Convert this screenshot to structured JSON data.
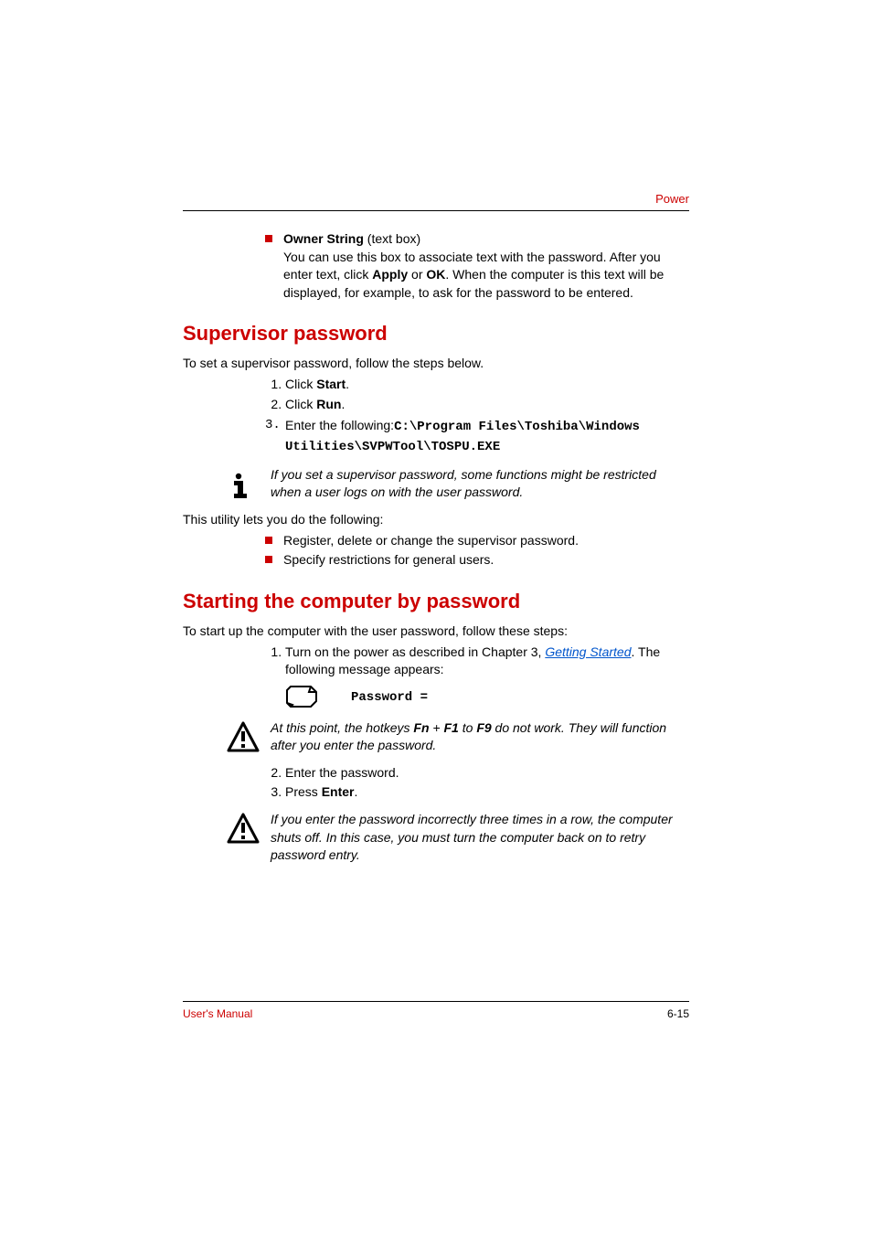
{
  "header": {
    "label": "Power"
  },
  "owner_bullet": {
    "title_bold": "Owner String",
    "title_rest": " (text box)",
    "desc1": "You can use this box to associate text with the password. After you enter text, click ",
    "desc_b1": "Apply",
    "desc_mid": " or ",
    "desc_b2": "OK",
    "desc2": ". When the computer is this text will be displayed, for example, to ask for the password to be entered."
  },
  "supervisor": {
    "heading": "Supervisor password",
    "intro": "To set a supervisor password, follow the steps below.",
    "step1_pre": "Click ",
    "step1_bold": "Start",
    "step1_post": ".",
    "step2_pre": "Click ",
    "step2_bold": "Run",
    "step2_post": ".",
    "step3_num": "3.",
    "step3_pre": "Enter the following:",
    "step3_code": "C:\\Program Files\\Toshiba\\Windows Utilities\\SVPWTool\\TOSPU.EXE",
    "note": "If you set a supervisor password, some functions might be restricted when a user logs on with the user password.",
    "utility_line": "This utility lets you do the following:",
    "bul1": "Register, delete or change the supervisor password.",
    "bul2": "Specify restrictions for general users."
  },
  "starting": {
    "heading": "Starting the computer by password",
    "intro": "To start up the computer with the user password, follow these steps:",
    "step1_pre": "Turn on the power as described in Chapter 3, ",
    "step1_link": "Getting Started",
    "step1_post": ". The following message appears:",
    "password_label": "Password =",
    "note1_pre": "At this point, the hotkeys ",
    "note1_b1": "Fn",
    "note1_plus": " + ",
    "note1_b2": "F1",
    "note1_mid": " to ",
    "note1_b3": "F9",
    "note1_post": " do not work. They will function after you enter the password.",
    "step2": "Enter the password.",
    "step3_pre": "Press ",
    "step3_bold": "Enter",
    "step3_post": ".",
    "note2": "If you enter the password incorrectly three times in a row, the computer shuts off. In this case, you must turn the computer back on to retry password entry."
  },
  "footer": {
    "left": "User's Manual",
    "right": "6-15"
  }
}
